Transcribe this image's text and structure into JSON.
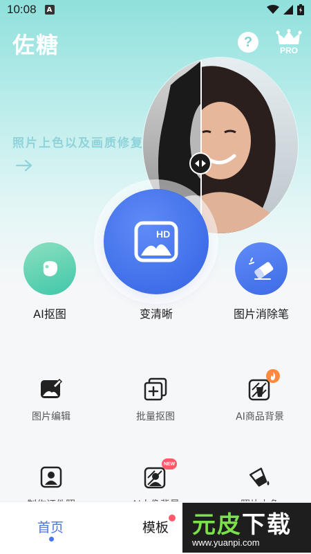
{
  "status_bar": {
    "time": "10:08",
    "notification_letter": "A"
  },
  "header": {
    "brand": "佐糖",
    "help_label": "?",
    "pro_label": "PRO"
  },
  "hero": {
    "tagline": "照片上色以及画质修复"
  },
  "main_actions": {
    "cutout_label": "AI抠图",
    "clear_label": "变清晰",
    "eraser_label": "图片消除笔",
    "hd_badge": "HD"
  },
  "tools": [
    {
      "label": "图片编辑",
      "icon": "image-edit-icon"
    },
    {
      "label": "批量抠图",
      "icon": "batch-cutout-icon"
    },
    {
      "label": "AI商品背景",
      "icon": "product-background-icon"
    },
    {
      "label": "制作证件照",
      "icon": "id-photo-icon"
    },
    {
      "label": "AI人像背景",
      "icon": "portrait-background-icon"
    },
    {
      "label": "照片上色",
      "icon": "paint-bucket-icon"
    }
  ],
  "badges": {
    "new": "NEW"
  },
  "bottom_nav": {
    "home": "首页",
    "templates": "模板"
  },
  "watermark": {
    "title_green": "元皮",
    "title_white": "下载",
    "url": "www.yuanpi.com"
  },
  "colors": {
    "accent_blue": "#3f6ee8",
    "accent_teal": "#3fc7a8",
    "hero_text": "#8fd3da",
    "nav_active": "#4a74ea",
    "badge_red": "#ff5a6a",
    "badge_orange": "#ff8a3d"
  }
}
